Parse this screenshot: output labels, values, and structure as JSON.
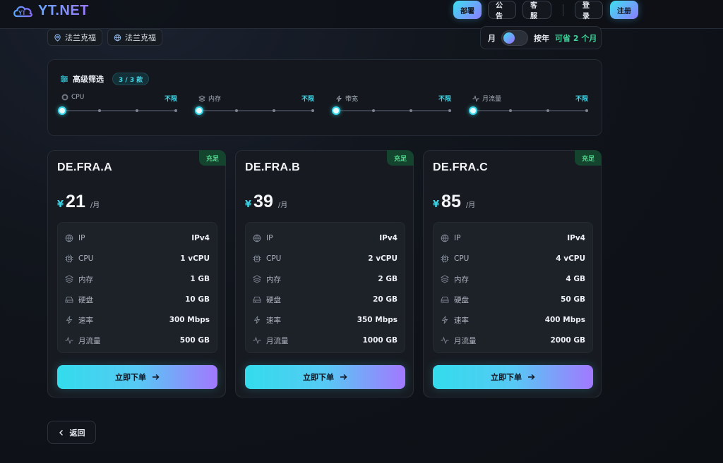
{
  "brand": {
    "name": "YT.NET"
  },
  "nav": {
    "deploy": "部署",
    "notice": "公告",
    "support": "客服",
    "login": "登录",
    "register": "注册"
  },
  "locations": [
    "法兰克福",
    "法兰克福"
  ],
  "billing": {
    "monthly": "月",
    "yearly": "按年",
    "save": "可省 2 个月"
  },
  "filter": {
    "title": "高级筛选",
    "count": "3 / 3 款",
    "sliders": [
      {
        "label": "CPU",
        "value": "不限",
        "icon": "cpu-icon"
      },
      {
        "label": "内存",
        "value": "不限",
        "icon": "layers-icon"
      },
      {
        "label": "带宽",
        "value": "不限",
        "icon": "bolt-icon"
      },
      {
        "label": "月流量",
        "value": "不限",
        "icon": "activity-icon"
      }
    ]
  },
  "plans": [
    {
      "name": "DE.FRA.A",
      "stock": "充足",
      "currency": "¥",
      "price": "21",
      "unit": "/月",
      "specs": [
        [
          "IP",
          "IPv4"
        ],
        [
          "CPU",
          "1 vCPU"
        ],
        [
          "内存",
          "1 GB"
        ],
        [
          "硬盘",
          "10 GB"
        ],
        [
          "速率",
          "300 Mbps"
        ],
        [
          "月流量",
          "500 GB"
        ]
      ]
    },
    {
      "name": "DE.FRA.B",
      "stock": "充足",
      "currency": "¥",
      "price": "39",
      "unit": "/月",
      "specs": [
        [
          "IP",
          "IPv4"
        ],
        [
          "CPU",
          "2 vCPU"
        ],
        [
          "内存",
          "2 GB"
        ],
        [
          "硬盘",
          "20 GB"
        ],
        [
          "速率",
          "350 Mbps"
        ],
        [
          "月流量",
          "1000 GB"
        ]
      ]
    },
    {
      "name": "DE.FRA.C",
      "stock": "充足",
      "currency": "¥",
      "price": "85",
      "unit": "/月",
      "specs": [
        [
          "IP",
          "IPv4"
        ],
        [
          "CPU",
          "4 vCPU"
        ],
        [
          "内存",
          "4 GB"
        ],
        [
          "硬盘",
          "50 GB"
        ],
        [
          "速率",
          "400 Mbps"
        ],
        [
          "月流量",
          "2000 GB"
        ]
      ]
    }
  ],
  "order_label": "立即下单",
  "back_label": "返回",
  "colors": {
    "accent": "#3ad2e4",
    "accent2": "#a278ff",
    "stock": "#52d98e"
  }
}
